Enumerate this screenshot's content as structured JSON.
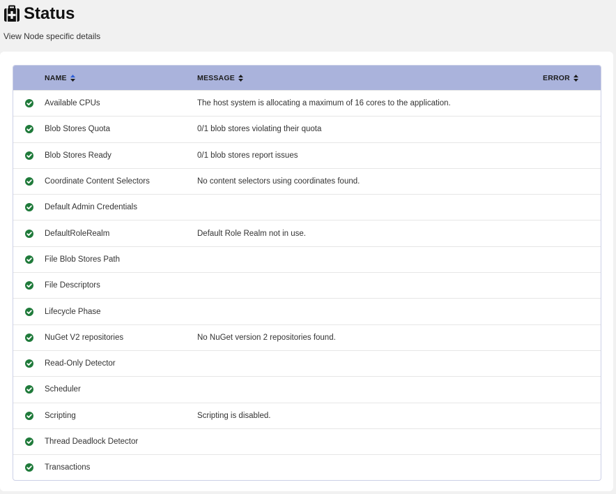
{
  "page": {
    "title": "Status",
    "subtitle": "View Node specific details"
  },
  "table": {
    "columns": {
      "name": "NAME",
      "message": "MESSAGE",
      "error": "ERROR"
    },
    "rows": [
      {
        "name": "Available CPUs",
        "message": "The host system is allocating a maximum of 16 cores to the application.",
        "error": "",
        "status": "healthy"
      },
      {
        "name": "Blob Stores Quota",
        "message": "0/1 blob stores violating their quota",
        "error": "",
        "status": "healthy"
      },
      {
        "name": "Blob Stores Ready",
        "message": "0/1 blob stores report issues",
        "error": "",
        "status": "healthy"
      },
      {
        "name": "Coordinate Content Selectors",
        "message": "No content selectors using coordinates found.",
        "error": "",
        "status": "healthy"
      },
      {
        "name": "Default Admin Credentials",
        "message": "",
        "error": "",
        "status": "healthy"
      },
      {
        "name": "DefaultRoleRealm",
        "message": "Default Role Realm not in use.",
        "error": "",
        "status": "healthy"
      },
      {
        "name": "File Blob Stores Path",
        "message": "",
        "error": "",
        "status": "healthy"
      },
      {
        "name": "File Descriptors",
        "message": "",
        "error": "",
        "status": "healthy"
      },
      {
        "name": "Lifecycle Phase",
        "message": "",
        "error": "",
        "status": "healthy"
      },
      {
        "name": "NuGet V2 repositories",
        "message": "No NuGet version 2 repositories found.",
        "error": "",
        "status": "healthy"
      },
      {
        "name": "Read-Only Detector",
        "message": "",
        "error": "",
        "status": "healthy"
      },
      {
        "name": "Scheduler",
        "message": "",
        "error": "",
        "status": "healthy"
      },
      {
        "name": "Scripting",
        "message": "Scripting is disabled.",
        "error": "",
        "status": "healthy"
      },
      {
        "name": "Thread Deadlock Detector",
        "message": "",
        "error": "",
        "status": "healthy"
      },
      {
        "name": "Transactions",
        "message": "",
        "error": "",
        "status": "healthy"
      }
    ]
  },
  "colors": {
    "header_bg": "#aab3dc",
    "healthy": "#1f7a3a",
    "sort_active": "#2d5fd6"
  },
  "icons": {
    "title": "medical-kit-icon",
    "status": "check-circle-icon",
    "sort": "sort-icon"
  }
}
